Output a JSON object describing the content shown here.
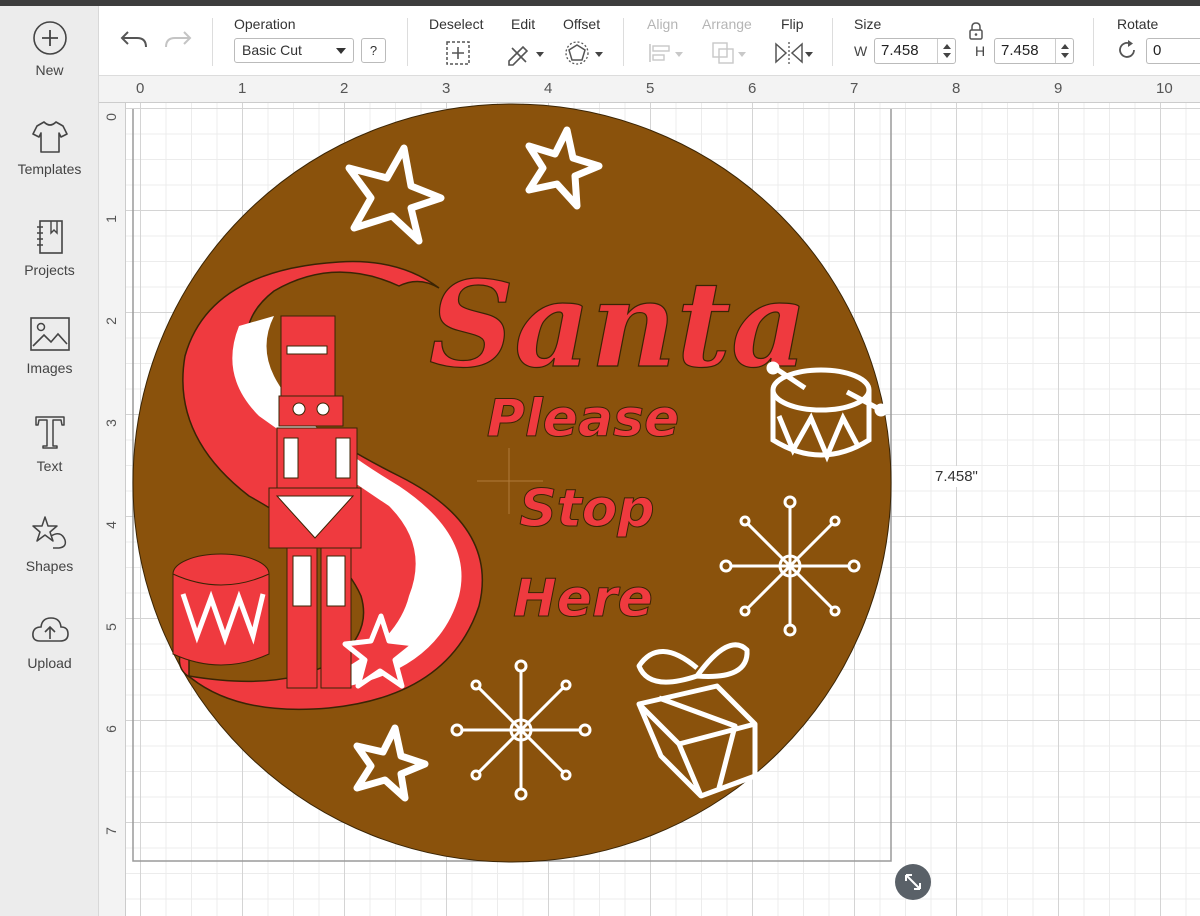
{
  "sidebar": {
    "items": [
      {
        "label": "New",
        "icon": "plus-circle-icon"
      },
      {
        "label": "Templates",
        "icon": "tshirt-icon"
      },
      {
        "label": "Projects",
        "icon": "notebook-icon"
      },
      {
        "label": "Images",
        "icon": "image-icon"
      },
      {
        "label": "Text",
        "icon": "text-t-icon"
      },
      {
        "label": "Shapes",
        "icon": "shapes-icon"
      },
      {
        "label": "Upload",
        "icon": "cloud-upload-icon"
      }
    ]
  },
  "toolbar": {
    "operation_label": "Operation",
    "operation_value": "Basic Cut",
    "help_label": "?",
    "deselect_label": "Deselect",
    "edit_label": "Edit",
    "offset_label": "Offset",
    "align_label": "Align",
    "arrange_label": "Arrange",
    "flip_label": "Flip",
    "size_label": "Size",
    "width_prefix": "W",
    "width_value": "7.458",
    "height_prefix": "H",
    "height_value": "7.458",
    "rotate_label": "Rotate",
    "rotate_value": "0"
  },
  "ruler": {
    "top": [
      "0",
      "1",
      "2",
      "3",
      "4",
      "5",
      "6",
      "7",
      "8",
      "9",
      "10"
    ],
    "left": [
      "0",
      "1",
      "2",
      "3",
      "4",
      "5",
      "6",
      "7"
    ]
  },
  "design": {
    "title_word": "Santa",
    "line1": "Please",
    "line2": "Stop",
    "line3": "Here",
    "background_color": "#8a520c",
    "accent_color": "#ef3a3f",
    "dimension_label": "7.458\""
  }
}
